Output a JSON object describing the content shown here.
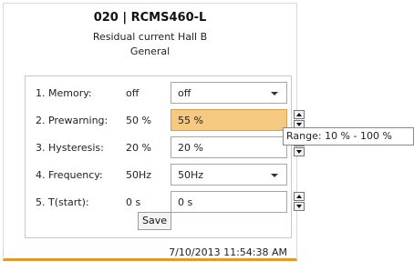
{
  "header": {
    "title": "020 | RCMS460-L",
    "subtitle": "Residual current Hall B",
    "group": "General"
  },
  "parameters": [
    {
      "label": "1. Memory:",
      "current": "off",
      "value": "off",
      "control": "dropdown"
    },
    {
      "label": "2. Prewarning:",
      "current": "50 %",
      "value": "55 %",
      "control": "spinner",
      "highlighted": true
    },
    {
      "label": "3. Hysteresis:",
      "current": "20 %",
      "value": "20 %",
      "control": "spinner"
    },
    {
      "label": "4. Frequency:",
      "current": "50Hz",
      "value": "50Hz",
      "control": "dropdown"
    },
    {
      "label": "5. T(start):",
      "current": "0 s",
      "value": "0 s",
      "control": "spinner"
    }
  ],
  "save_label": "Save",
  "timestamp": "7/10/2013 11:54:38 AM",
  "tooltip": "Range: 10 % - 100 %",
  "colors": {
    "highlight": "#f6c981",
    "accent_border": "#e39a2c"
  }
}
